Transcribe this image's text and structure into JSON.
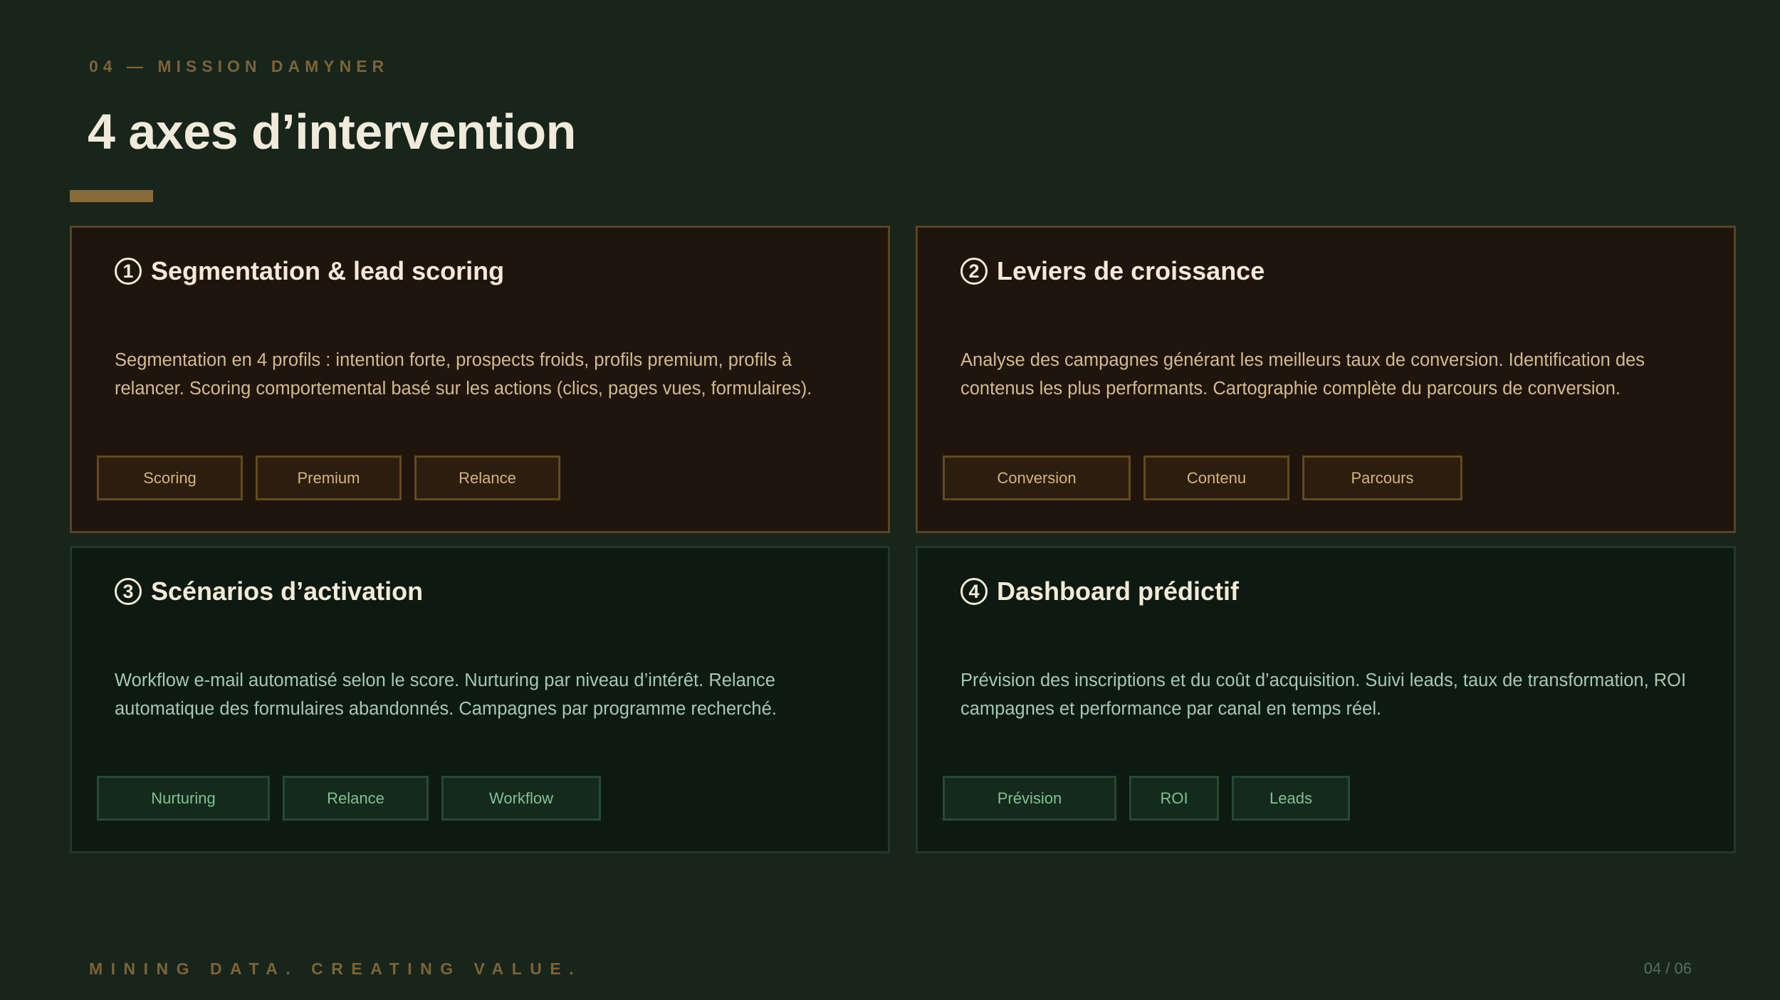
{
  "header": {
    "eyebrow": "04 — MISSION DAMYNER",
    "title": "4 axes d’intervention"
  },
  "cards": [
    {
      "number": "1",
      "title": "Segmentation & lead scoring",
      "description": "Segmentation en 4 profils : intention forte, prospects froids, profils premium, profils à relancer. Scoring comportemental basé sur les actions (clics, pages vues, formulaires).",
      "tags": [
        "Scoring",
        "Premium",
        "Relance"
      ]
    },
    {
      "number": "2",
      "title": "Leviers de croissance",
      "description": "Analyse des campagnes générant les meilleurs taux de conversion. Identification des contenus les plus performants. Cartographie complète du parcours de conversion.",
      "tags": [
        "Conversion",
        "Contenu",
        "Parcours"
      ]
    },
    {
      "number": "3",
      "title": "Scénarios d’activation",
      "description": "Workflow e-mail automatisé selon le score. Nurturing par niveau d’intérêt. Relance automatique des formulaires abandonnés. Campagnes par programme recherché.",
      "tags": [
        "Nurturing",
        "Relance",
        "Workflow"
      ]
    },
    {
      "number": "4",
      "title": "Dashboard prédictif",
      "description": "Prévision des inscriptions et du coût d’acquisition. Suivi leads, taux de transformation, ROI campagnes et performance par canal en temps réel.",
      "tags": [
        "Prévision",
        "ROI",
        "Leads"
      ]
    }
  ],
  "footer": {
    "tagline": "MINING DATA. CREATING VALUE.",
    "page": "04 / 06"
  },
  "colors": {
    "background": "#17251b",
    "accent_gold": "#8a6a3b",
    "warm_card": "#1f150d",
    "cool_card": "#0d1a12",
    "title_text": "#f1eadb"
  }
}
